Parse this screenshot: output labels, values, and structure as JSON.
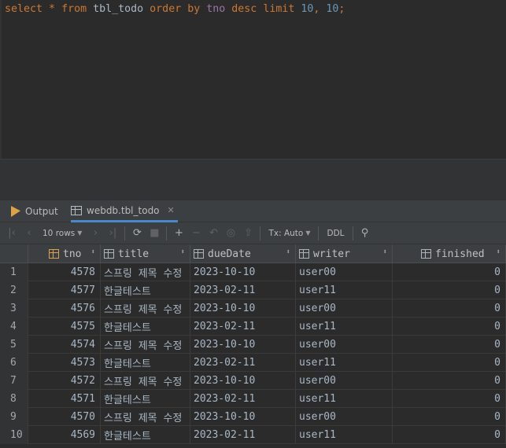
{
  "editor": {
    "tokens": [
      {
        "t": "select",
        "c": "kw"
      },
      {
        "t": " * ",
        "c": "kw"
      },
      {
        "t": "from",
        "c": "kw"
      },
      {
        "t": " tbl_todo ",
        "c": "id"
      },
      {
        "t": "order by",
        "c": "kw"
      },
      {
        "t": " ",
        "c": "id"
      },
      {
        "t": "tno",
        "c": "col"
      },
      {
        "t": " ",
        "c": "id"
      },
      {
        "t": "desc",
        "c": "kw"
      },
      {
        "t": " ",
        "c": "id"
      },
      {
        "t": "limit",
        "c": "kw"
      },
      {
        "t": " ",
        "c": "id"
      },
      {
        "t": "10",
        "c": "num"
      },
      {
        "t": ", ",
        "c": "kw"
      },
      {
        "t": "10",
        "c": "num"
      },
      {
        "t": ";",
        "c": "kw"
      }
    ]
  },
  "tabs": {
    "output_label": "Output",
    "table_label": "webdb.tbl_todo",
    "close_glyph": "✕"
  },
  "toolbar": {
    "rows_label": "10 rows",
    "tx_label": "Tx: Auto",
    "ddl_label": "DDL"
  },
  "grid": {
    "columns": [
      {
        "name": "tno",
        "key": true
      },
      {
        "name": "title",
        "key": false
      },
      {
        "name": "dueDate",
        "key": false
      },
      {
        "name": "writer",
        "key": false
      },
      {
        "name": "finished",
        "key": false
      }
    ],
    "rows": [
      {
        "n": "1",
        "tno": "4578",
        "title": "스프링 제목 수정",
        "dueDate": "2023-10-10",
        "writer": "user00",
        "finished": "0"
      },
      {
        "n": "2",
        "tno": "4577",
        "title": "한글테스트",
        "dueDate": "2023-02-11",
        "writer": "user11",
        "finished": "0"
      },
      {
        "n": "3",
        "tno": "4576",
        "title": "스프링 제목 수정",
        "dueDate": "2023-10-10",
        "writer": "user00",
        "finished": "0"
      },
      {
        "n": "4",
        "tno": "4575",
        "title": "한글테스트",
        "dueDate": "2023-02-11",
        "writer": "user11",
        "finished": "0"
      },
      {
        "n": "5",
        "tno": "4574",
        "title": "스프링 제목 수정",
        "dueDate": "2023-10-10",
        "writer": "user00",
        "finished": "0"
      },
      {
        "n": "6",
        "tno": "4573",
        "title": "한글테스트",
        "dueDate": "2023-02-11",
        "writer": "user11",
        "finished": "0"
      },
      {
        "n": "7",
        "tno": "4572",
        "title": "스프링 제목 수정",
        "dueDate": "2023-10-10",
        "writer": "user00",
        "finished": "0"
      },
      {
        "n": "8",
        "tno": "4571",
        "title": "한글테스트",
        "dueDate": "2023-02-11",
        "writer": "user11",
        "finished": "0"
      },
      {
        "n": "9",
        "tno": "4570",
        "title": "스프링 제목 수정",
        "dueDate": "2023-10-10",
        "writer": "user00",
        "finished": "0"
      },
      {
        "n": "10",
        "tno": "4569",
        "title": "한글테스트",
        "dueDate": "2023-02-11",
        "writer": "user11",
        "finished": "0"
      }
    ]
  }
}
